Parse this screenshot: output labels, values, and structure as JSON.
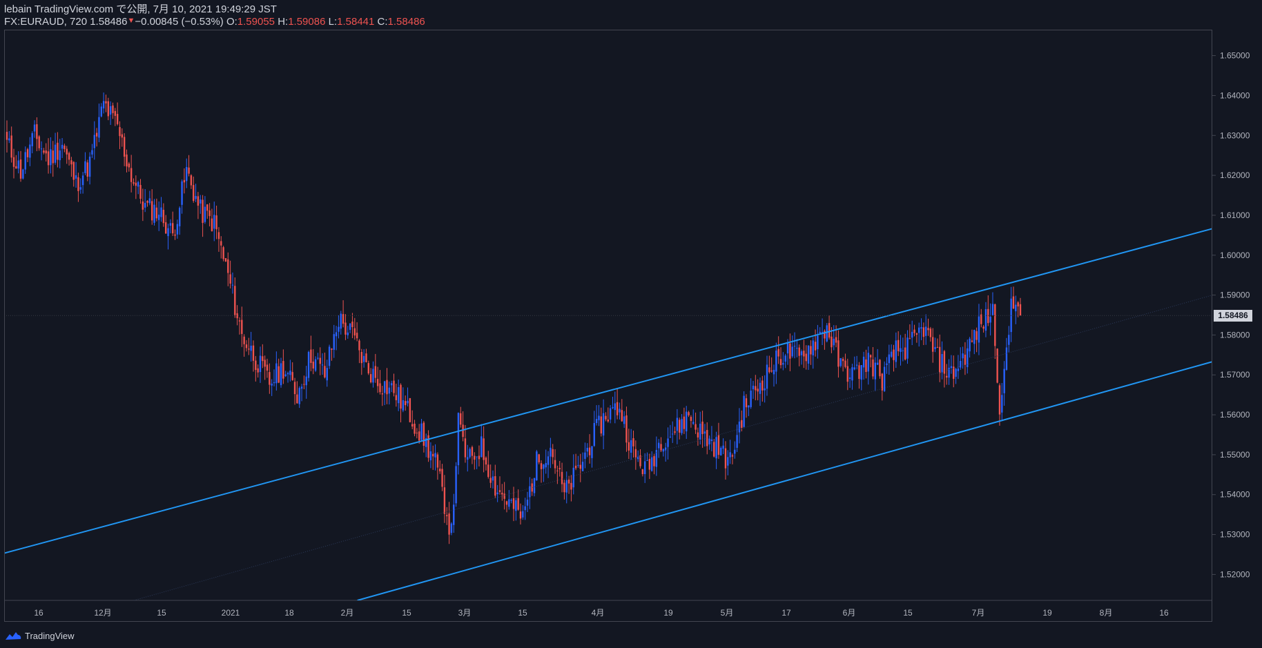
{
  "header": {
    "line1": "lebain TradingView.com で公開, 7月 10, 2021 19:49:29 JST",
    "symbol": "FX:EURAUD, 720",
    "last": "1.58486",
    "change": "−0.00845 (−0.53%)",
    "o_label": "O:",
    "o": "1.59055",
    "h_label": "H:",
    "h": "1.59086",
    "l_label": "L:",
    "l": "1.58441",
    "c_label": "C:",
    "c": "1.58486"
  },
  "price_tag": "1.58486",
  "footer": {
    "brand": "TradingView"
  },
  "colors": {
    "background": "#131722",
    "up": "#2962ff",
    "down": "#ef5350",
    "trendline": "#2196f3",
    "text": "#d1d4dc",
    "grid": "#2a2e39"
  },
  "chart_data": {
    "type": "candlestick",
    "title": "",
    "symbol": "FX:EURAUD",
    "interval": "720",
    "ylim": [
      1.5135,
      1.6565
    ],
    "y_ticks": [
      "1.52000",
      "1.53000",
      "1.54000",
      "1.55000",
      "1.56000",
      "1.57000",
      "1.58000",
      "1.59000",
      "1.60000",
      "1.61000",
      "1.62000",
      "1.63000",
      "1.64000",
      "1.65000"
    ],
    "x_ticks": [
      "16",
      "12月",
      "15",
      "2021",
      "18",
      "2月",
      "15",
      "3月",
      "15",
      "4月",
      "19",
      "5月",
      "17",
      "6月",
      "15",
      "7月",
      "19",
      "8月",
      "16"
    ],
    "last_price": 1.58486,
    "price_anchors": [
      [
        0,
        1.628
      ],
      [
        6,
        1.621
      ],
      [
        12,
        1.63
      ],
      [
        18,
        1.624
      ],
      [
        24,
        1.628
      ],
      [
        30,
        1.618
      ],
      [
        36,
        1.623
      ],
      [
        42,
        1.638
      ],
      [
        48,
        1.632
      ],
      [
        54,
        1.62
      ],
      [
        60,
        1.612
      ],
      [
        66,
        1.611
      ],
      [
        72,
        1.605
      ],
      [
        78,
        1.621
      ],
      [
        84,
        1.611
      ],
      [
        90,
        1.608
      ],
      [
        96,
        1.595
      ],
      [
        102,
        1.58
      ],
      [
        108,
        1.574
      ],
      [
        114,
        1.568
      ],
      [
        120,
        1.572
      ],
      [
        126,
        1.565
      ],
      [
        132,
        1.575
      ],
      [
        138,
        1.57
      ],
      [
        144,
        1.584
      ],
      [
        150,
        1.58
      ],
      [
        156,
        1.572
      ],
      [
        162,
        1.568
      ],
      [
        168,
        1.566
      ],
      [
        174,
        1.561
      ],
      [
        180,
        1.555
      ],
      [
        186,
        1.548
      ],
      [
        190,
        1.538
      ],
      [
        193,
        1.53
      ],
      [
        196,
        1.558
      ],
      [
        200,
        1.548
      ],
      [
        206,
        1.552
      ],
      [
        212,
        1.542
      ],
      [
        218,
        1.538
      ],
      [
        224,
        1.534
      ],
      [
        230,
        1.548
      ],
      [
        236,
        1.552
      ],
      [
        242,
        1.54
      ],
      [
        248,
        1.546
      ],
      [
        254,
        1.554
      ],
      [
        260,
        1.56
      ],
      [
        266,
        1.562
      ],
      [
        272,
        1.55
      ],
      [
        278,
        1.546
      ],
      [
        284,
        1.554
      ],
      [
        290,
        1.556
      ],
      [
        296,
        1.56
      ],
      [
        302,
        1.555
      ],
      [
        308,
        1.552
      ],
      [
        314,
        1.548
      ],
      [
        320,
        1.562
      ],
      [
        326,
        1.567
      ],
      [
        332,
        1.572
      ],
      [
        338,
        1.576
      ],
      [
        344,
        1.574
      ],
      [
        350,
        1.578
      ],
      [
        356,
        1.582
      ],
      [
        362,
        1.572
      ],
      [
        368,
        1.57
      ],
      [
        374,
        1.574
      ],
      [
        380,
        1.569
      ],
      [
        386,
        1.576
      ],
      [
        392,
        1.577
      ],
      [
        398,
        1.582
      ],
      [
        404,
        1.574
      ],
      [
        410,
        1.57
      ],
      [
        416,
        1.575
      ],
      [
        422,
        1.582
      ],
      [
        428,
        1.586
      ],
      [
        431,
        1.563
      ],
      [
        434,
        1.574
      ],
      [
        436,
        1.588
      ],
      [
        438,
        1.59
      ],
      [
        440,
        1.5849
      ]
    ],
    "trend_lines": [
      {
        "name": "upper",
        "from": [
          "2020-11-04",
          1.5243
        ],
        "to": [
          "2021-08-30",
          1.6076
        ]
      },
      {
        "name": "lower",
        "from": [
          "2021-02-01",
          1.5135
        ],
        "to": [
          "2021-08-30",
          1.5743
        ]
      },
      {
        "name": "mid",
        "from": [
          "2020-12-09",
          1.5135
        ],
        "to": [
          "2021-08-30",
          1.591
        ]
      }
    ]
  }
}
